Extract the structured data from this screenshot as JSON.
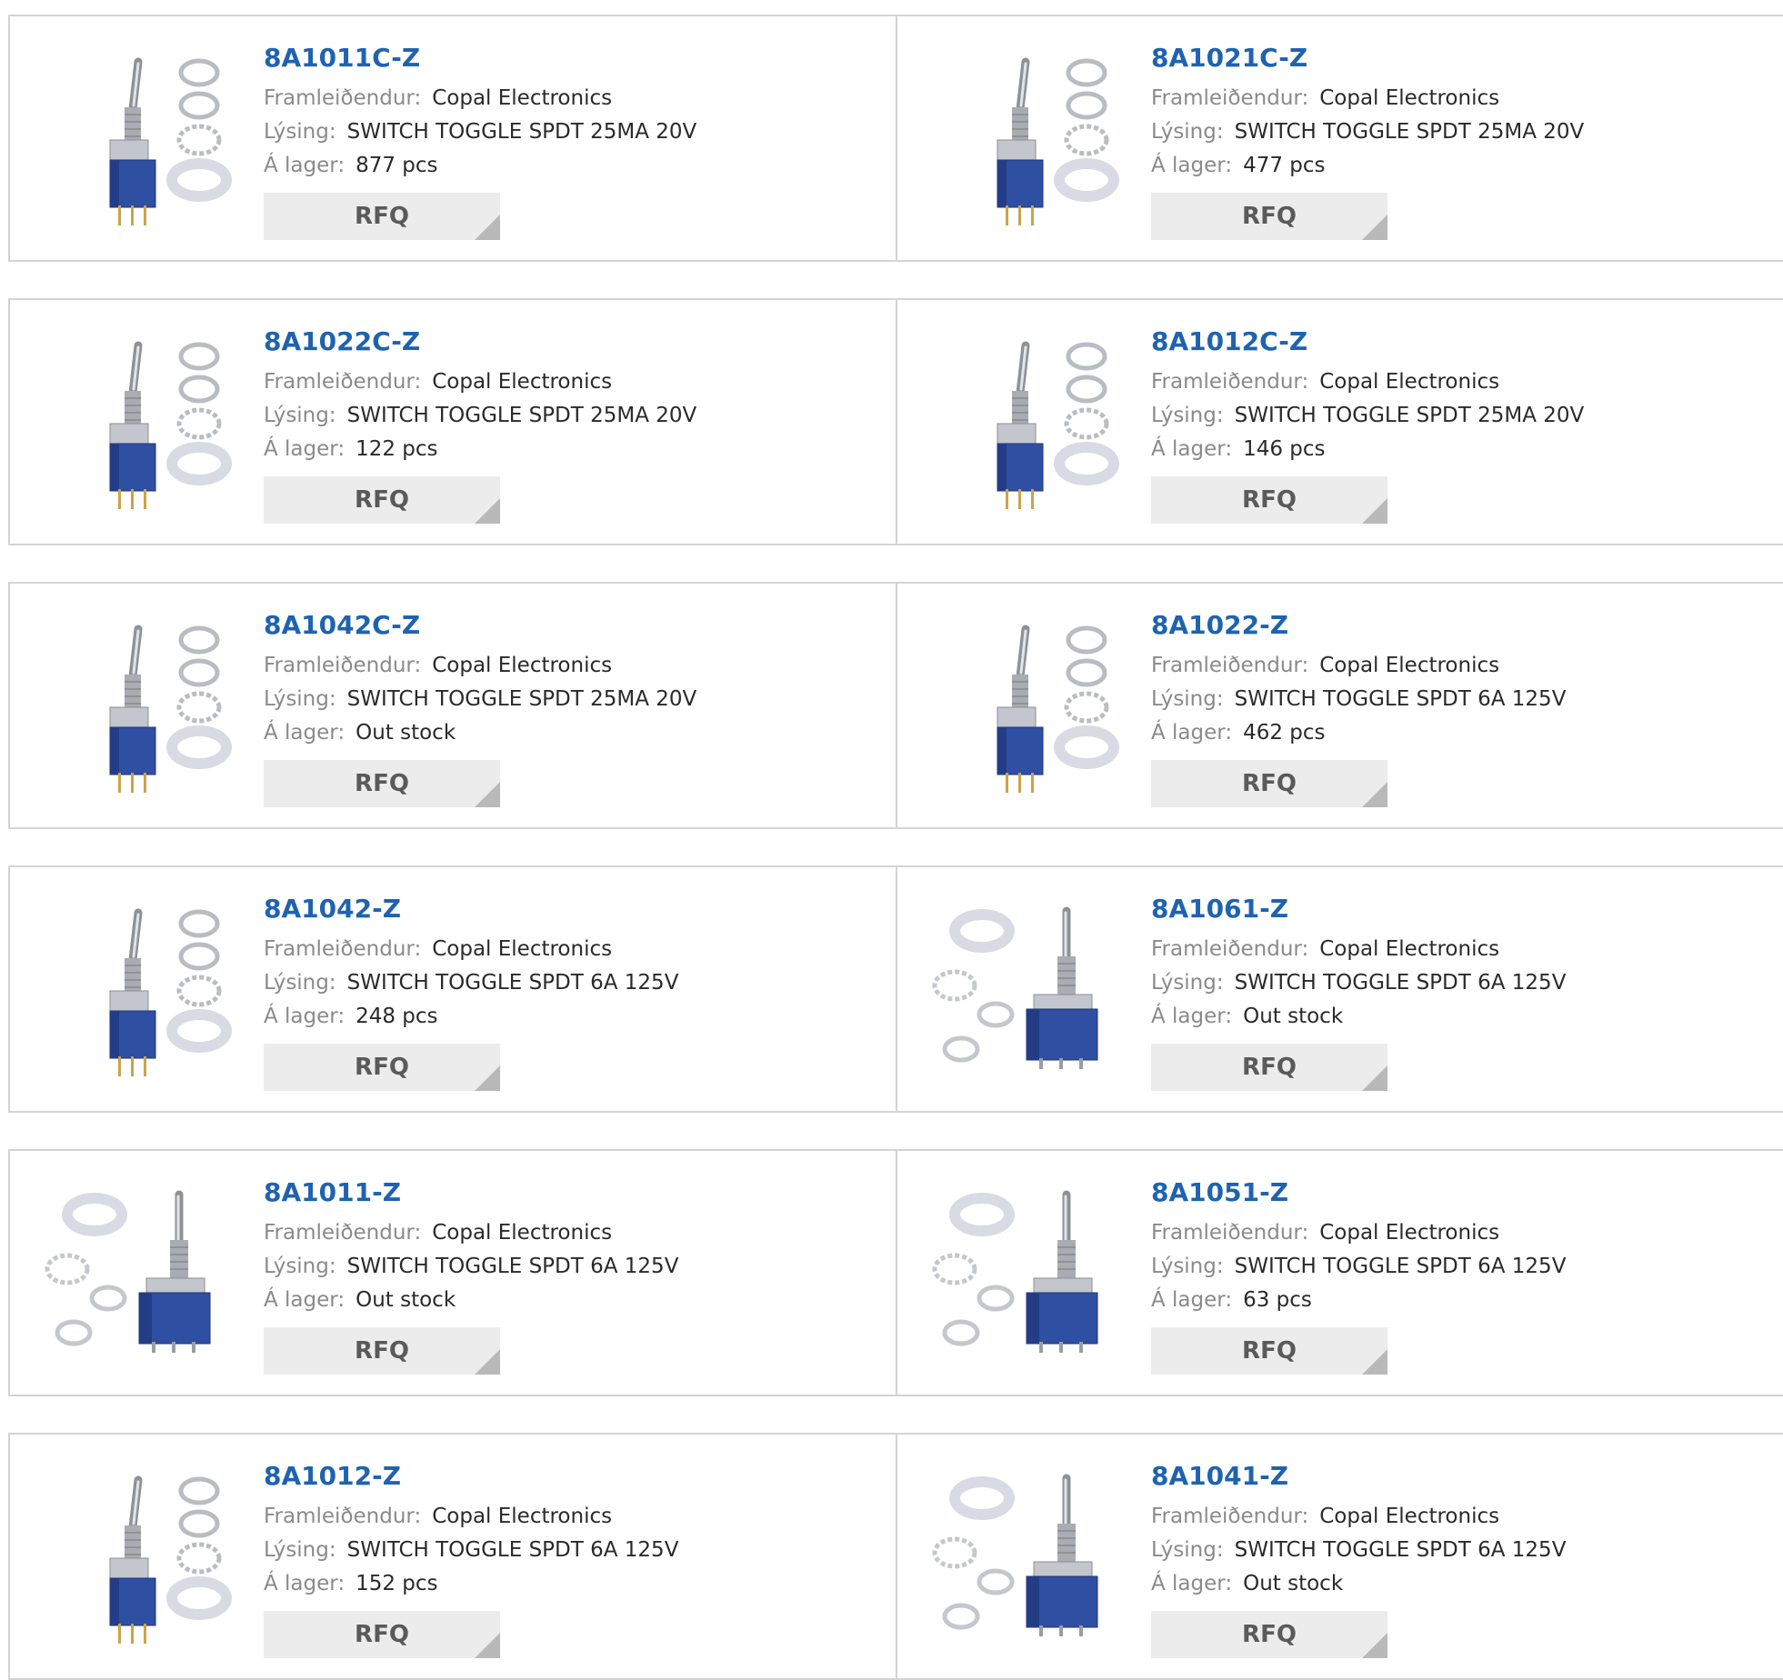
{
  "labels": {
    "manufacturer": "Framleiðendur:",
    "description": "Lýsing:",
    "stock": "Á lager:",
    "rfq": "RFQ"
  },
  "products": [
    {
      "part": "8A1011C-Z",
      "manufacturer": "Copal Electronics",
      "description": "SWITCH TOGGLE SPDT 25MA 20V",
      "stock": "877 pcs",
      "image": "vertical-toggle-switch-with-washers"
    },
    {
      "part": "8A1021C-Z",
      "manufacturer": "Copal Electronics",
      "description": "SWITCH TOGGLE SPDT 25MA 20V",
      "stock": "477 pcs",
      "image": "vertical-toggle-switch-with-washers"
    },
    {
      "part": "8A1022C-Z",
      "manufacturer": "Copal Electronics",
      "description": "SWITCH TOGGLE SPDT 25MA 20V",
      "stock": "122 pcs",
      "image": "vertical-toggle-switch-with-washers"
    },
    {
      "part": "8A1012C-Z",
      "manufacturer": "Copal Electronics",
      "description": "SWITCH TOGGLE SPDT 25MA 20V",
      "stock": "146 pcs",
      "image": "vertical-toggle-switch-with-washers"
    },
    {
      "part": "8A1042C-Z",
      "manufacturer": "Copal Electronics",
      "description": "SWITCH TOGGLE SPDT 25MA 20V",
      "stock": "Out stock",
      "image": "vertical-toggle-switch-with-washers"
    },
    {
      "part": "8A1022-Z",
      "manufacturer": "Copal Electronics",
      "description": "SWITCH TOGGLE SPDT 6A 125V",
      "stock": "462 pcs",
      "image": "vertical-toggle-switch-with-washers"
    },
    {
      "part": "8A1042-Z",
      "manufacturer": "Copal Electronics",
      "description": "SWITCH TOGGLE SPDT 6A 125V",
      "stock": "248 pcs",
      "image": "vertical-toggle-switch-with-washers"
    },
    {
      "part": "8A1061-Z",
      "manufacturer": "Copal Electronics",
      "description": "SWITCH TOGGLE SPDT 6A 125V",
      "stock": "Out stock",
      "image": "angled-toggle-switch-with-washers"
    },
    {
      "part": "8A1011-Z",
      "manufacturer": "Copal Electronics",
      "description": "SWITCH TOGGLE SPDT 6A 125V",
      "stock": "Out stock",
      "image": "angled-toggle-switch-with-washers"
    },
    {
      "part": "8A1051-Z",
      "manufacturer": "Copal Electronics",
      "description": "SWITCH TOGGLE SPDT 6A 125V",
      "stock": "63 pcs",
      "image": "angled-toggle-switch-with-washers"
    },
    {
      "part": "8A1012-Z",
      "manufacturer": "Copal Electronics",
      "description": "SWITCH TOGGLE SPDT 6A 125V",
      "stock": "152 pcs",
      "image": "vertical-toggle-switch-with-washers"
    },
    {
      "part": "8A1041-Z",
      "manufacturer": "Copal Electronics",
      "description": "SWITCH TOGGLE SPDT 6A 125V",
      "stock": "Out stock",
      "image": "angled-toggle-switch-with-washers"
    }
  ],
  "colors": {
    "link": "#1f63b0",
    "switch_body": "#2f4fa3",
    "metal": "#b9bcc2",
    "button_bg": "#ececec"
  }
}
